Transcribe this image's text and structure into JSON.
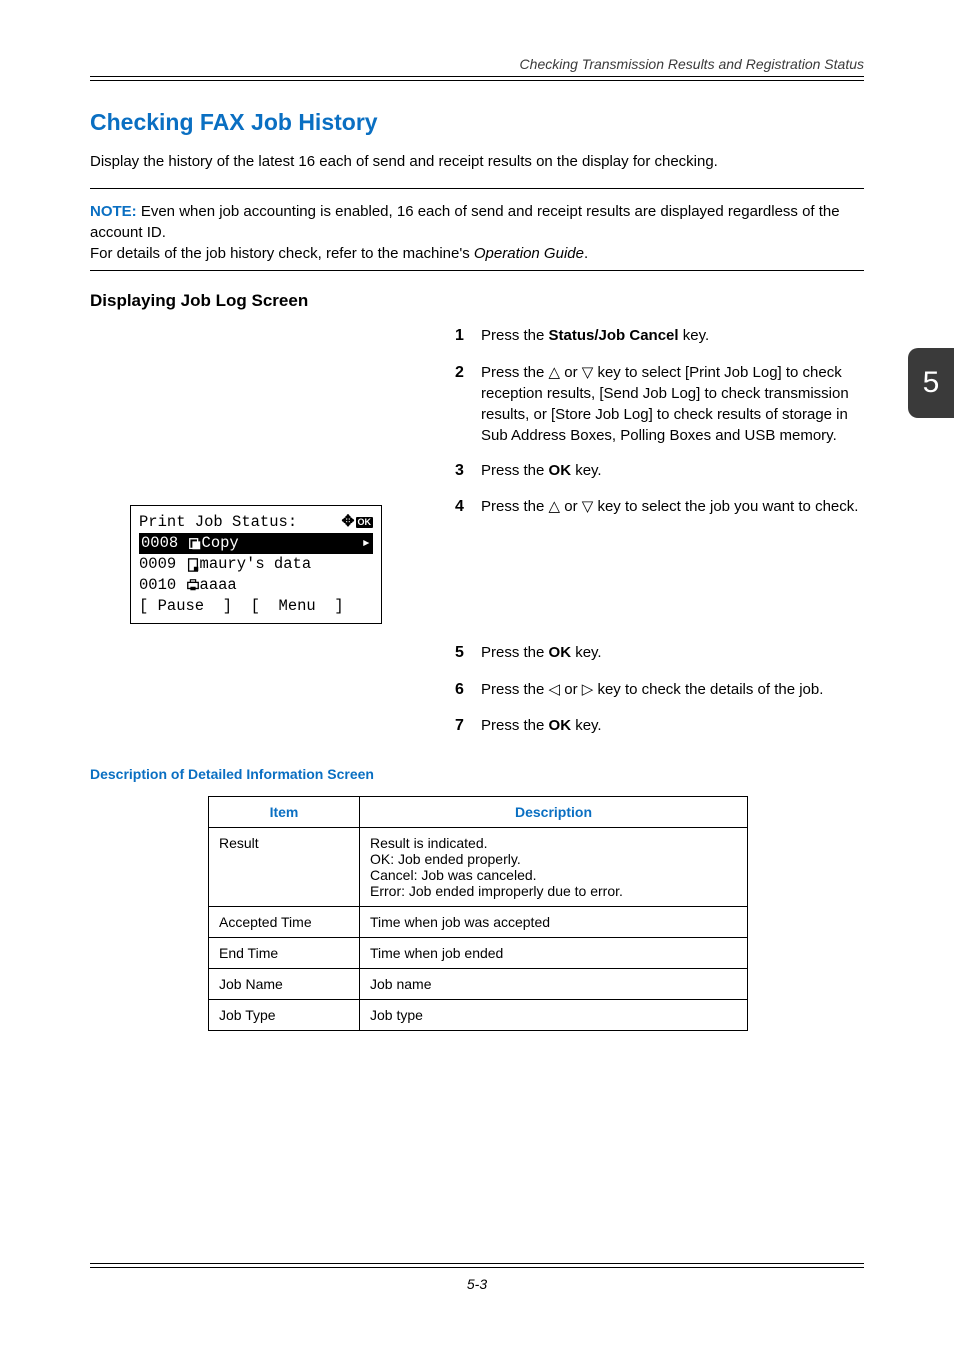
{
  "running_head": "Checking Transmission Results and Registration Status",
  "section_title": "Checking FAX Job History",
  "intro": "Display the history of the latest 16 each of send and receipt results on the display for checking.",
  "note_label": "NOTE:",
  "note_body": " Even when job accounting is enabled, 16 each of send and receipt results are displayed regardless of the account ID.",
  "note_body2_a": "For details of the job history check, refer to the machine's ",
  "note_body2_b": "Operation Guide",
  "note_body2_c": ".",
  "subhead": "Displaying Job Log Screen",
  "steps": {
    "s1_a": "Press the ",
    "s1_b": "Status/Job Cancel",
    "s1_c": " key.",
    "s2": "Press the △ or ▽ key to select [Print Job Log] to check reception results, [Send Job Log] to check transmission results, or [Store Job Log] to check results of storage in Sub Address Boxes, Polling Boxes and USB memory.",
    "s3_a": "Press the ",
    "s3_b": "OK",
    "s3_c": " key.",
    "s4": "Press the △ or ▽ key to select the job you want to check.",
    "s5_a": "Press the ",
    "s5_b": "OK",
    "s5_c": " key.",
    "s6": "Press the ◁ or ▷ key to check the details of the job.",
    "s7_a": "Press the ",
    "s7_b": "OK",
    "s7_c": " key."
  },
  "lcd": {
    "title": "Print Job Status:",
    "row1_a": "0008 ",
    "row1_b": "Copy",
    "row2": "0009   maury's data",
    "row3": "0010   aaaa",
    "row4": "[ Pause  ]  [  Menu  ]"
  },
  "desc_heading": "Description of Detailed Information Screen",
  "table": {
    "hdr_item": "Item",
    "hdr_desc": "Description",
    "rows": [
      {
        "item": "Result",
        "desc": "Result is indicated.\nOK: Job ended properly.\nCancel: Job was canceled.\nError: Job ended improperly due to error."
      },
      {
        "item": "Accepted Time",
        "desc": "Time when job was accepted"
      },
      {
        "item": "End Time",
        "desc": "Time when job ended"
      },
      {
        "item": "Job Name",
        "desc": "Job name"
      },
      {
        "item": "Job Type",
        "desc": "Job type"
      }
    ]
  },
  "page_num": "5-3",
  "thumb": "5"
}
